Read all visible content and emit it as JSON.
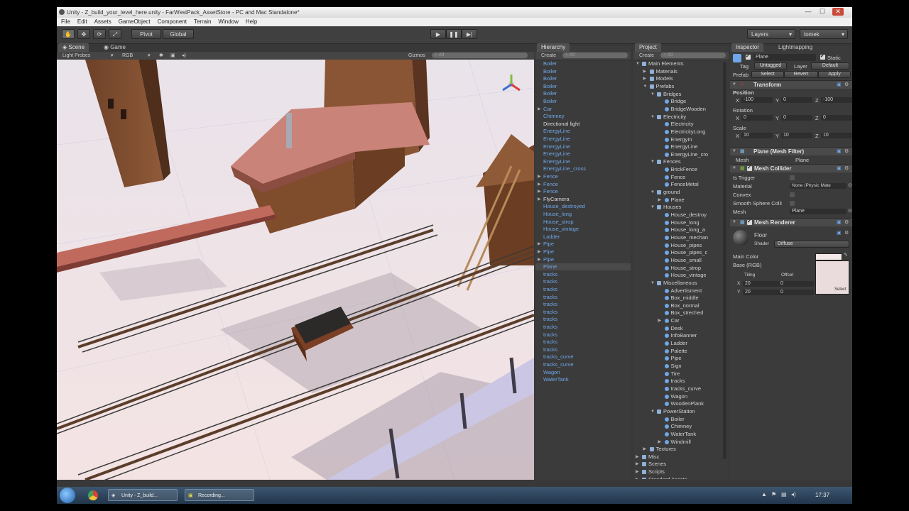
{
  "window": {
    "title": "Unity - Z_build_your_level_here.unity - FarWestPack_AssetStore - PC and Mac Standalone*",
    "minimize": "—",
    "maximize": "☐",
    "close": "✕"
  },
  "menu": [
    "File",
    "Edit",
    "Assets",
    "GameObject",
    "Component",
    "Terrain",
    "Window",
    "Help"
  ],
  "toolbar": {
    "pivot": "Pivot",
    "global": "Global",
    "play": "▶",
    "pause": "❚❚",
    "step": "▶|",
    "layers": "Layers",
    "layout": "tomek"
  },
  "scene": {
    "tab_scene": "Scene",
    "tab_game": "Game",
    "light_probes": "Light Probes",
    "rgb": "RGB",
    "gizmos": "Gizmos",
    "search": "All"
  },
  "hierarchy": {
    "tab": "Hierarchy",
    "create": "Create",
    "search": "All",
    "items": [
      {
        "label": "Boiler",
        "arrow": "",
        "white": false
      },
      {
        "label": "Boiler",
        "arrow": "",
        "white": false
      },
      {
        "label": "Boiler",
        "arrow": "",
        "white": false
      },
      {
        "label": "Boiler",
        "arrow": "",
        "white": false
      },
      {
        "label": "Boiler",
        "arrow": "",
        "white": false
      },
      {
        "label": "Boiler",
        "arrow": "",
        "white": false
      },
      {
        "label": "Car",
        "arrow": "▶",
        "white": false
      },
      {
        "label": "Chimney",
        "arrow": "",
        "white": false
      },
      {
        "label": "Directional light",
        "arrow": "",
        "white": true
      },
      {
        "label": "EnergyLine",
        "arrow": "",
        "white": false
      },
      {
        "label": "EnergyLine",
        "arrow": "",
        "white": false
      },
      {
        "label": "EnergyLine",
        "arrow": "",
        "white": false
      },
      {
        "label": "EnergyLine",
        "arrow": "",
        "white": false
      },
      {
        "label": "EnergyLine",
        "arrow": "",
        "white": false
      },
      {
        "label": "EnergyLine_cross",
        "arrow": "",
        "white": false
      },
      {
        "label": "Fence",
        "arrow": "▶",
        "white": false
      },
      {
        "label": "Fence",
        "arrow": "▶",
        "white": false
      },
      {
        "label": "Fence",
        "arrow": "▶",
        "white": false
      },
      {
        "label": "FlyCamera",
        "arrow": "▶",
        "white": true
      },
      {
        "label": "House_destroyed",
        "arrow": "",
        "white": false
      },
      {
        "label": "House_long",
        "arrow": "",
        "white": false
      },
      {
        "label": "House_strop",
        "arrow": "",
        "white": false
      },
      {
        "label": "House_vintage",
        "arrow": "",
        "white": false
      },
      {
        "label": "Ladder",
        "arrow": "",
        "white": false
      },
      {
        "label": "Pipe",
        "arrow": "▶",
        "white": false
      },
      {
        "label": "Pipe",
        "arrow": "▶",
        "white": false
      },
      {
        "label": "Pipe",
        "arrow": "▶",
        "white": false
      },
      {
        "label": "Plane",
        "arrow": "",
        "white": false
      },
      {
        "label": "tracks",
        "arrow": "",
        "white": false
      },
      {
        "label": "tracks",
        "arrow": "",
        "white": false
      },
      {
        "label": "tracks",
        "arrow": "",
        "white": false
      },
      {
        "label": "tracks",
        "arrow": "",
        "white": false
      },
      {
        "label": "tracks",
        "arrow": "",
        "white": false
      },
      {
        "label": "tracks",
        "arrow": "",
        "white": false
      },
      {
        "label": "tracks",
        "arrow": "",
        "white": false
      },
      {
        "label": "tracks",
        "arrow": "",
        "white": false
      },
      {
        "label": "tracks",
        "arrow": "",
        "white": false
      },
      {
        "label": "tracks",
        "arrow": "",
        "white": false
      },
      {
        "label": "tracks",
        "arrow": "",
        "white": false
      },
      {
        "label": "tracks_curve",
        "arrow": "",
        "white": false
      },
      {
        "label": "tracks_curve",
        "arrow": "",
        "white": false
      },
      {
        "label": "Wagon",
        "arrow": "",
        "white": false
      },
      {
        "label": "WaterTank",
        "arrow": "",
        "white": false
      }
    ],
    "selected_label": "Plane"
  },
  "project": {
    "tab": "Project",
    "create": "Create",
    "search": "All",
    "items": [
      {
        "label": "Main Elements",
        "level": 0,
        "arrow": "▼",
        "type": "folder"
      },
      {
        "label": "Materials",
        "level": 1,
        "arrow": "▶",
        "type": "folder"
      },
      {
        "label": "Models",
        "level": 1,
        "arrow": "▶",
        "type": "folder"
      },
      {
        "label": "Prefabs",
        "level": 1,
        "arrow": "▼",
        "type": "folder"
      },
      {
        "label": "Bridges",
        "level": 2,
        "arrow": "▼",
        "type": "folder"
      },
      {
        "label": "Bridge",
        "level": 3,
        "arrow": "",
        "type": "prefab"
      },
      {
        "label": "BridgeWooden",
        "level": 3,
        "arrow": "",
        "type": "prefab"
      },
      {
        "label": "Electricity",
        "level": 2,
        "arrow": "▼",
        "type": "folder"
      },
      {
        "label": "Electricity",
        "level": 3,
        "arrow": "",
        "type": "prefab"
      },
      {
        "label": "ElectricityLong",
        "level": 3,
        "arrow": "",
        "type": "prefab"
      },
      {
        "label": "EnergyIn",
        "level": 3,
        "arrow": "",
        "type": "prefab"
      },
      {
        "label": "EnergyLine",
        "level": 3,
        "arrow": "",
        "type": "prefab"
      },
      {
        "label": "EnergyLine_cro",
        "level": 3,
        "arrow": "",
        "type": "prefab"
      },
      {
        "label": "Fences",
        "level": 2,
        "arrow": "▼",
        "type": "folder"
      },
      {
        "label": "BrickFence",
        "level": 3,
        "arrow": "",
        "type": "prefab"
      },
      {
        "label": "Fence",
        "level": 3,
        "arrow": "",
        "type": "prefab"
      },
      {
        "label": "FenceMetal",
        "level": 3,
        "arrow": "",
        "type": "prefab"
      },
      {
        "label": "ground",
        "level": 2,
        "arrow": "▼",
        "type": "folder"
      },
      {
        "label": "Plane",
        "level": 3,
        "arrow": "▶",
        "type": "prefab"
      },
      {
        "label": "Houses",
        "level": 2,
        "arrow": "▼",
        "type": "folder"
      },
      {
        "label": "House_destroy",
        "level": 3,
        "arrow": "",
        "type": "prefab"
      },
      {
        "label": "House_long",
        "level": 3,
        "arrow": "",
        "type": "prefab"
      },
      {
        "label": "House_long_a",
        "level": 3,
        "arrow": "",
        "type": "prefab"
      },
      {
        "label": "House_mechan",
        "level": 3,
        "arrow": "",
        "type": "prefab"
      },
      {
        "label": "House_pipes",
        "level": 3,
        "arrow": "",
        "type": "prefab"
      },
      {
        "label": "House_pipes_c",
        "level": 3,
        "arrow": "",
        "type": "prefab"
      },
      {
        "label": "House_small",
        "level": 3,
        "arrow": "",
        "type": "prefab"
      },
      {
        "label": "House_strop",
        "level": 3,
        "arrow": "",
        "type": "prefab"
      },
      {
        "label": "House_vintage",
        "level": 3,
        "arrow": "",
        "type": "prefab"
      },
      {
        "label": "Miscellaneous",
        "level": 2,
        "arrow": "▼",
        "type": "folder"
      },
      {
        "label": "Advertisment",
        "level": 3,
        "arrow": "",
        "type": "prefab"
      },
      {
        "label": "Box_middle",
        "level": 3,
        "arrow": "",
        "type": "prefab"
      },
      {
        "label": "Box_normal",
        "level": 3,
        "arrow": "",
        "type": "prefab"
      },
      {
        "label": "Box_streched",
        "level": 3,
        "arrow": "",
        "type": "prefab"
      },
      {
        "label": "Car",
        "level": 3,
        "arrow": "▶",
        "type": "prefab"
      },
      {
        "label": "Desk",
        "level": 3,
        "arrow": "",
        "type": "prefab"
      },
      {
        "label": "InfoBanner",
        "level": 3,
        "arrow": "",
        "type": "prefab"
      },
      {
        "label": "Ladder",
        "level": 3,
        "arrow": "",
        "type": "prefab"
      },
      {
        "label": "Palette",
        "level": 3,
        "arrow": "",
        "type": "prefab"
      },
      {
        "label": "Pipe",
        "level": 3,
        "arrow": "",
        "type": "prefab"
      },
      {
        "label": "Sign",
        "level": 3,
        "arrow": "",
        "type": "prefab"
      },
      {
        "label": "Tire",
        "level": 3,
        "arrow": "",
        "type": "prefab"
      },
      {
        "label": "tracks",
        "level": 3,
        "arrow": "",
        "type": "prefab"
      },
      {
        "label": "tracks_curve",
        "level": 3,
        "arrow": "",
        "type": "prefab"
      },
      {
        "label": "Wagon",
        "level": 3,
        "arrow": "",
        "type": "prefab"
      },
      {
        "label": "WoodenPlank",
        "level": 3,
        "arrow": "",
        "type": "prefab"
      },
      {
        "label": "PowerStation",
        "level": 2,
        "arrow": "▼",
        "type": "folder"
      },
      {
        "label": "Boiler",
        "level": 3,
        "arrow": "",
        "type": "prefab"
      },
      {
        "label": "Chimney",
        "level": 3,
        "arrow": "",
        "type": "prefab"
      },
      {
        "label": "WaterTank",
        "level": 3,
        "arrow": "",
        "type": "prefab"
      },
      {
        "label": "Windmill",
        "level": 3,
        "arrow": "▶",
        "type": "prefab"
      },
      {
        "label": "Textures",
        "level": 1,
        "arrow": "▶",
        "type": "folder"
      },
      {
        "label": "Misc",
        "level": 0,
        "arrow": "▶",
        "type": "folder"
      },
      {
        "label": "Scenes",
        "level": 0,
        "arrow": "▶",
        "type": "folder"
      },
      {
        "label": "Scripts",
        "level": 0,
        "arrow": "▶",
        "type": "folder"
      },
      {
        "label": "Standard Assets",
        "level": 0,
        "arrow": "▶",
        "type": "folder"
      }
    ]
  },
  "inspector": {
    "tab": "Inspector",
    "tab2": "Lightmapping",
    "name": "Plane",
    "static": "Static",
    "tag_label": "Tag",
    "tag": "Untagged",
    "layer_label": "Layer",
    "layer": "Default",
    "prefab_label": "Prefab",
    "select": "Select",
    "revert": "Revert",
    "apply": "Apply",
    "transform": "Transform",
    "position": "Position",
    "rotation": "Rotation",
    "scale": "Scale",
    "x": "X",
    "y": "Y",
    "z": "Z",
    "pos": [
      "-100",
      "0",
      "-100"
    ],
    "rot": [
      "0",
      "0",
      "0"
    ],
    "scl": [
      "10",
      "10",
      "10"
    ],
    "mesh_filter": "Plane (Mesh Filter)",
    "mesh_label": "Mesh",
    "mesh_value": "Plane",
    "mesh_collider": "Mesh Collider",
    "is_trigger": "Is Trigger",
    "material": "Material",
    "material_value": "None (Physic Mate",
    "convex": "Convex",
    "smooth": "Smooth Sphere Colli",
    "mesh_renderer": "Mesh Renderer",
    "mat_name": "Floor",
    "shader_label": "Shader",
    "shader": "Diffuse",
    "main_color": "Main Color",
    "base": "Base (RGB)",
    "tiling": "Tiling",
    "offset": "Offset",
    "tx": "20",
    "ty": "20",
    "ox": "0",
    "oy": "0",
    "tex_select": "Select"
  },
  "taskbar": {
    "task1": "Unity - Z_build...",
    "task2": "Recording...",
    "time": "17:37"
  },
  "colors": {
    "accent_blue": "#6fa7e8",
    "selected_row": "#4a5a70"
  }
}
